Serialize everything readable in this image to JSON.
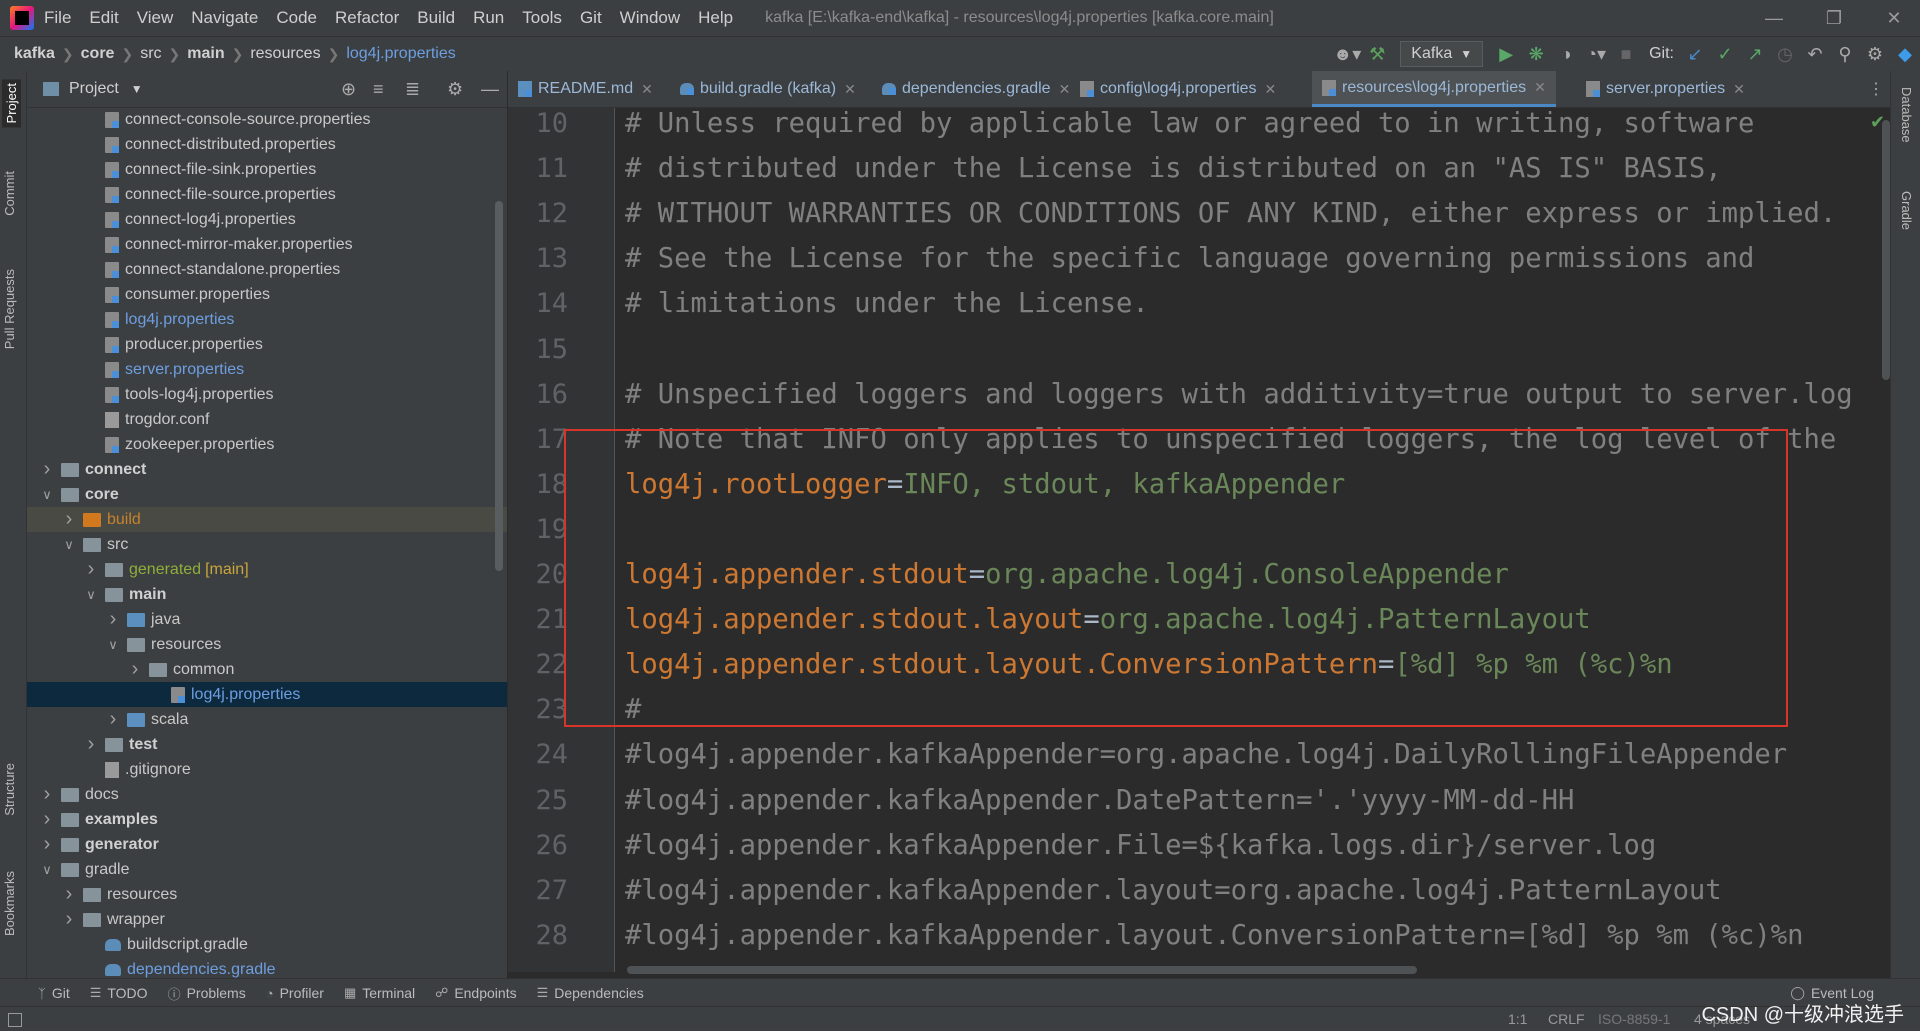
{
  "menubar": {
    "items": [
      "File",
      "Edit",
      "View",
      "Navigate",
      "Code",
      "Refactor",
      "Build",
      "Run",
      "Tools",
      "Git",
      "Window",
      "Help"
    ],
    "window_title": "kafka [E:\\kafka-end\\kafka] - resources\\log4j.properties [kafka.core.main]"
  },
  "navbar": {
    "breadcrumbs": [
      "kafka",
      "core",
      "src",
      "main",
      "resources",
      "log4j.properties"
    ],
    "run_config": "Kafka",
    "git_label": "Git:"
  },
  "left_strip": {
    "tabs": [
      "Project",
      "Commit",
      "Pull Requests",
      "Structure",
      "Bookmarks"
    ]
  },
  "right_strip": {
    "tabs": [
      "Database",
      "Gradle"
    ]
  },
  "project": {
    "title": "Project",
    "tree": [
      {
        "name": "connect-console-source.properties",
        "indent": 3,
        "icon": "properties-file"
      },
      {
        "name": "connect-distributed.properties",
        "indent": 3,
        "icon": "properties-file"
      },
      {
        "name": "connect-file-sink.properties",
        "indent": 3,
        "icon": "properties-file"
      },
      {
        "name": "connect-file-source.properties",
        "indent": 3,
        "icon": "properties-file"
      },
      {
        "name": "connect-log4j.properties",
        "indent": 3,
        "icon": "properties-file"
      },
      {
        "name": "connect-mirror-maker.properties",
        "indent": 3,
        "icon": "properties-file"
      },
      {
        "name": "connect-standalone.properties",
        "indent": 3,
        "icon": "properties-file"
      },
      {
        "name": "consumer.properties",
        "indent": 3,
        "icon": "properties-file"
      },
      {
        "name": "log4j.properties",
        "indent": 3,
        "icon": "properties-file",
        "style": "blue"
      },
      {
        "name": "producer.properties",
        "indent": 3,
        "icon": "properties-file"
      },
      {
        "name": "server.properties",
        "indent": 3,
        "icon": "properties-file",
        "style": "blue"
      },
      {
        "name": "tools-log4j.properties",
        "indent": 3,
        "icon": "properties-file"
      },
      {
        "name": "trogdor.conf",
        "indent": 3,
        "icon": "text-file"
      },
      {
        "name": "zookeeper.properties",
        "indent": 3,
        "icon": "properties-file"
      },
      {
        "name": "connect",
        "indent": 1,
        "icon": "folder",
        "chevron": "collapsed",
        "style": "bold"
      },
      {
        "name": "core",
        "indent": 1,
        "icon": "folder",
        "chevron": "expanded",
        "style": "bold"
      },
      {
        "name": "build",
        "indent": 2,
        "icon": "folder-orange",
        "chevron": "collapsed",
        "style": "orange",
        "row": "highlight"
      },
      {
        "name": "src",
        "indent": 2,
        "icon": "folder",
        "chevron": "expanded"
      },
      {
        "name": "generated",
        "tag": "[main]",
        "indent": 3,
        "icon": "folder",
        "chevron": "collapsed",
        "style": "green"
      },
      {
        "name": "main",
        "indent": 3,
        "icon": "folder",
        "chevron": "expanded",
        "style": "bold"
      },
      {
        "name": "java",
        "indent": 4,
        "icon": "folder-blue",
        "chevron": "collapsed"
      },
      {
        "name": "resources",
        "indent": 4,
        "icon": "folder",
        "chevron": "expanded"
      },
      {
        "name": "common",
        "indent": 5,
        "icon": "folder",
        "chevron": "collapsed"
      },
      {
        "name": "log4j.properties",
        "indent": 6,
        "icon": "properties-file",
        "style": "blue",
        "row": "selected"
      },
      {
        "name": "scala",
        "indent": 4,
        "icon": "folder-blue",
        "chevron": "collapsed"
      },
      {
        "name": "test",
        "indent": 3,
        "icon": "folder",
        "chevron": "collapsed",
        "style": "bold"
      },
      {
        "name": ".gitignore",
        "indent": 3,
        "icon": "text-file"
      },
      {
        "name": "docs",
        "indent": 1,
        "icon": "folder",
        "chevron": "collapsed"
      },
      {
        "name": "examples",
        "indent": 1,
        "icon": "folder",
        "chevron": "collapsed",
        "style": "bold"
      },
      {
        "name": "generator",
        "indent": 1,
        "icon": "folder",
        "chevron": "collapsed",
        "style": "bold"
      },
      {
        "name": "gradle",
        "indent": 1,
        "icon": "folder",
        "chevron": "expanded"
      },
      {
        "name": "resources",
        "indent": 2,
        "icon": "folder",
        "chevron": "collapsed"
      },
      {
        "name": "wrapper",
        "indent": 2,
        "icon": "folder",
        "chevron": "collapsed"
      },
      {
        "name": "buildscript.gradle",
        "indent": 3,
        "icon": "gradle-file"
      },
      {
        "name": "dependencies.gradle",
        "indent": 3,
        "icon": "gradle-file",
        "style": "blue"
      }
    ]
  },
  "editor": {
    "tabs": [
      {
        "label": "README.md",
        "icon": "md"
      },
      {
        "label": "build.gradle (kafka)",
        "icon": "gradle"
      },
      {
        "label": "dependencies.gradle",
        "icon": "gradle"
      },
      {
        "label": "config\\log4j.properties",
        "icon": "properties"
      },
      {
        "label": "resources\\log4j.properties",
        "icon": "properties",
        "active": true
      },
      {
        "label": "server.properties",
        "icon": "properties"
      }
    ],
    "lines": [
      {
        "n": "10",
        "parts": [
          {
            "t": "cmt",
            "s": "# Unless required by applicable law or agreed to in writing, software"
          }
        ]
      },
      {
        "n": "11",
        "parts": [
          {
            "t": "cmt",
            "s": "# distributed under the License is distributed on an \"AS IS\" BASIS,"
          }
        ]
      },
      {
        "n": "12",
        "parts": [
          {
            "t": "cmt",
            "s": "# WITHOUT WARRANTIES OR CONDITIONS OF ANY KIND, either express or implied."
          }
        ]
      },
      {
        "n": "13",
        "parts": [
          {
            "t": "cmt",
            "s": "# See the License for the specific language governing permissions and"
          }
        ]
      },
      {
        "n": "14",
        "parts": [
          {
            "t": "cmt",
            "s": "# limitations under the License."
          }
        ]
      },
      {
        "n": "15",
        "parts": []
      },
      {
        "n": "16",
        "parts": [
          {
            "t": "cmt",
            "s": "# Unspecified loggers and loggers with additivity=true output to server.log"
          }
        ]
      },
      {
        "n": "17",
        "parts": [
          {
            "t": "cmt",
            "s": "# Note that INFO only applies to unspecified loggers, the log level of the"
          }
        ]
      },
      {
        "n": "18",
        "parts": [
          {
            "t": "key",
            "s": "log4j.rootLogger"
          },
          {
            "t": "eq",
            "s": "="
          },
          {
            "t": "val",
            "s": "INFO, stdout, kafkaAppender"
          }
        ]
      },
      {
        "n": "19",
        "parts": []
      },
      {
        "n": "20",
        "parts": [
          {
            "t": "key",
            "s": "log4j.appender.stdout"
          },
          {
            "t": "eq",
            "s": "="
          },
          {
            "t": "val",
            "s": "org.apache.log4j.ConsoleAppender"
          }
        ]
      },
      {
        "n": "21",
        "parts": [
          {
            "t": "key",
            "s": "log4j.appender.stdout.layout"
          },
          {
            "t": "eq",
            "s": "="
          },
          {
            "t": "val",
            "s": "org.apache.log4j.PatternLayout"
          }
        ]
      },
      {
        "n": "22",
        "parts": [
          {
            "t": "key",
            "s": "log4j.appender.stdout.layout.ConversionPattern"
          },
          {
            "t": "eq",
            "s": "="
          },
          {
            "t": "val",
            "s": "[%d] %p %m (%c)%n"
          }
        ]
      },
      {
        "n": "23",
        "parts": [
          {
            "t": "cmt",
            "s": "#"
          }
        ]
      },
      {
        "n": "24",
        "parts": [
          {
            "t": "cmt",
            "s": "#log4j.appender.kafkaAppender=org.apache.log4j.DailyRollingFileAppender"
          }
        ]
      },
      {
        "n": "25",
        "parts": [
          {
            "t": "cmt",
            "s": "#log4j.appender.kafkaAppender.DatePattern='.'yyyy-MM-dd-HH"
          }
        ]
      },
      {
        "n": "26",
        "parts": [
          {
            "t": "cmt",
            "s": "#log4j.appender.kafkaAppender.File=${kafka.logs.dir}/server.log"
          }
        ]
      },
      {
        "n": "27",
        "parts": [
          {
            "t": "cmt",
            "s": "#log4j.appender.kafkaAppender.layout=org.apache.log4j.PatternLayout"
          }
        ]
      },
      {
        "n": "28",
        "parts": [
          {
            "t": "cmt",
            "s": "#log4j.appender.kafkaAppender.layout.ConversionPattern=[%d] %p %m (%c)%n"
          }
        ]
      }
    ]
  },
  "bottom_tools": [
    "Git",
    "TODO",
    "Problems",
    "Profiler",
    "Terminal",
    "Endpoints",
    "Dependencies"
  ],
  "status": {
    "event_log": "Event Log",
    "position": "1:1",
    "line_sep": "CRLF",
    "encoding": "ISO-8859-1",
    "indent": "4 spaces"
  },
  "watermark": "CSDN @十级冲浪选手",
  "colors": {
    "comment": "#808080",
    "key": "#cc7832",
    "value": "#6a8759",
    "annotation_box": "#d7342a",
    "accent": "#4a88c7"
  }
}
